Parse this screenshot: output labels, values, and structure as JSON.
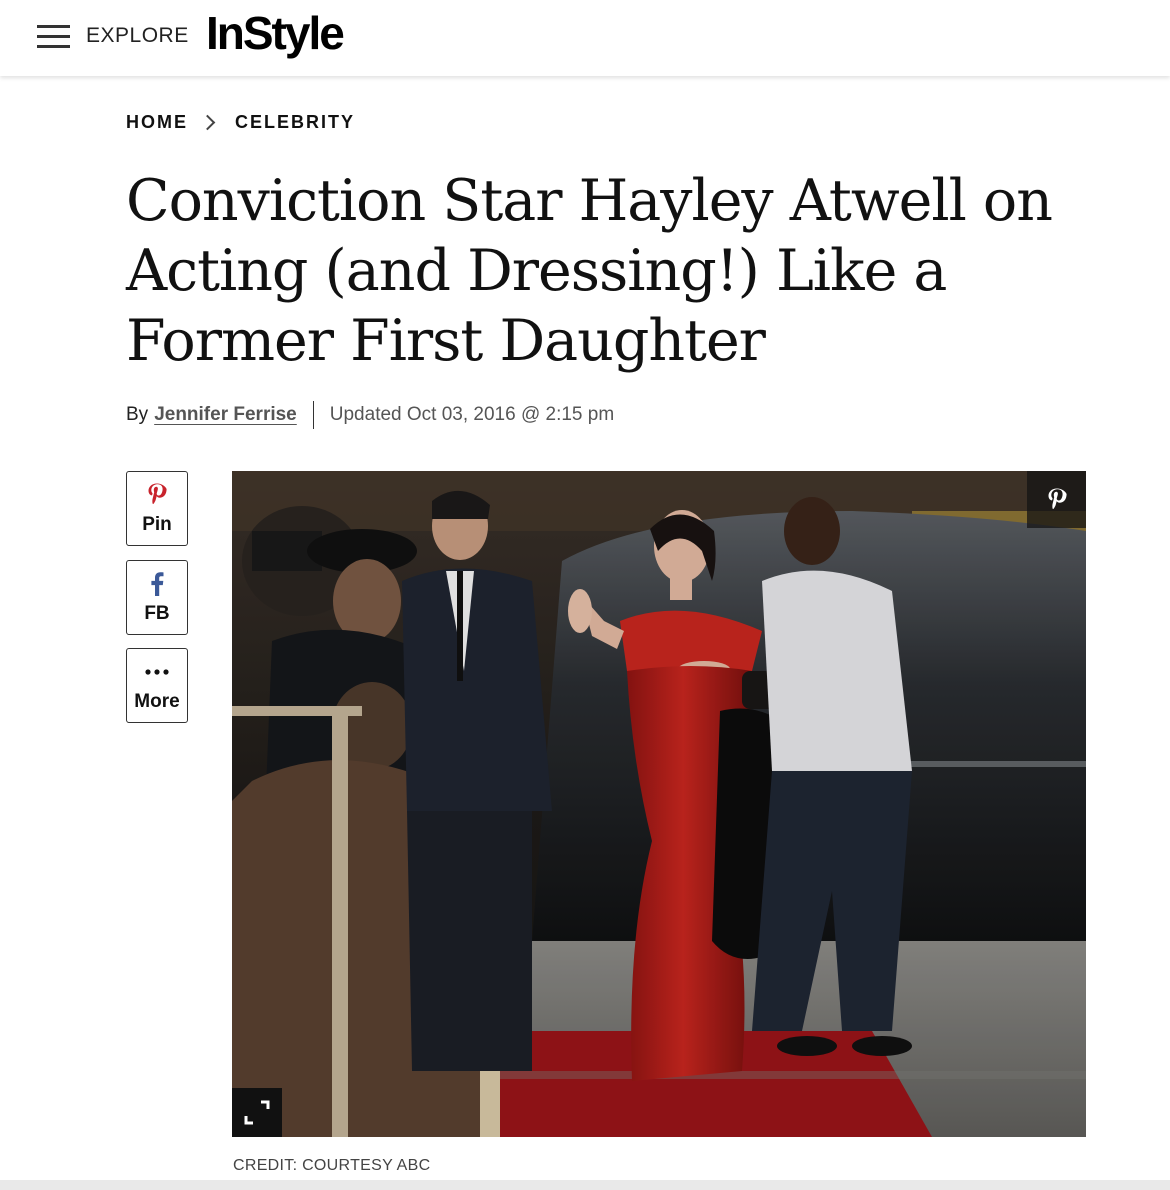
{
  "header": {
    "explore_label": "EXPLORE",
    "logo_text": "InStyle"
  },
  "breadcrumb": [
    "HOME",
    "CELEBRITY"
  ],
  "article": {
    "headline": "Conviction Star Hayley Atwell on Acting (and Dressing!) Like a Former First Daughter",
    "by_prefix": "By",
    "author": "Jennifer Ferrise",
    "updated": "Updated Oct 03, 2016 @ 2:15 pm"
  },
  "share": {
    "pin_label": "Pin",
    "fb_label": "FB",
    "more_label": "More"
  },
  "image": {
    "credit": "CREDIT: COURTESY ABC"
  },
  "colors": {
    "pinterest": "#c8232c",
    "facebook": "#3b5998",
    "dress": "#c0211f",
    "carpet": "#9a1418"
  },
  "icons": [
    "menu-icon",
    "chevron-right-icon",
    "pinterest-icon",
    "facebook-icon",
    "more-dots-icon",
    "expand-icon"
  ]
}
